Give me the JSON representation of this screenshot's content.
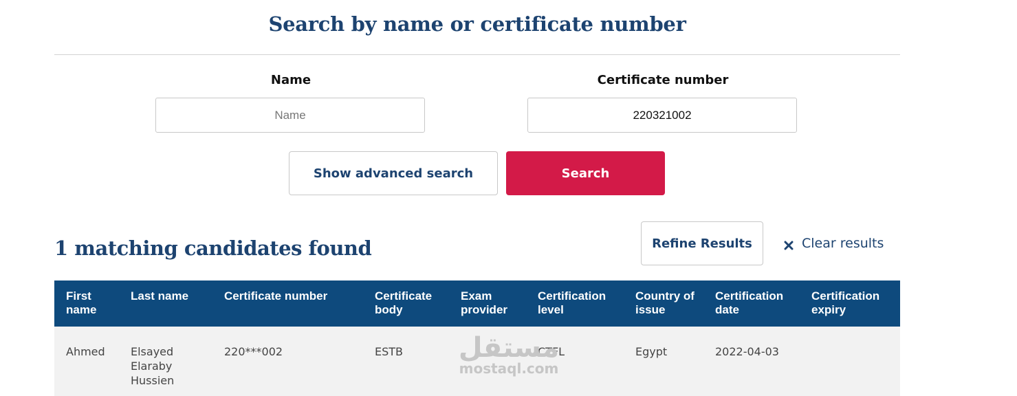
{
  "search": {
    "title": "Search by name or certificate number",
    "name_label": "Name",
    "name_placeholder": "Name",
    "name_value": "",
    "cert_label": "Certificate number",
    "cert_placeholder": "",
    "cert_value": "220321002",
    "advanced_button": "Show advanced search",
    "search_button": "Search"
  },
  "results": {
    "heading": "1 matching candidates found",
    "refine_button": "Refine Results",
    "clear_label": "Clear results",
    "columns": [
      "First\nname",
      "Last name",
      "Certificate number",
      "Certificate\nbody",
      "Exam\nprovider",
      "Certification\nlevel",
      "Country of\nissue",
      "Certification\ndate",
      "Certification\nexpiry"
    ],
    "rows": [
      {
        "first_name": "Ahmed",
        "last_name": "Elsayed\nElaraby\nHussien",
        "certificate_number": "220***002",
        "certificate_body": "ESTB",
        "exam_provider": "",
        "certification_level": "CTFL",
        "country_of_issue": "Egypt",
        "certification_date": "2022-04-03",
        "certification_expiry": ""
      }
    ]
  },
  "watermark": {
    "main": "مستقل",
    "sub": "mostaql.com"
  },
  "colors": {
    "heading": "#1d4370",
    "table_header_bg": "#0e4a7d",
    "search_button_bg": "#d31a48",
    "row_bg": "#f2f2f2"
  }
}
